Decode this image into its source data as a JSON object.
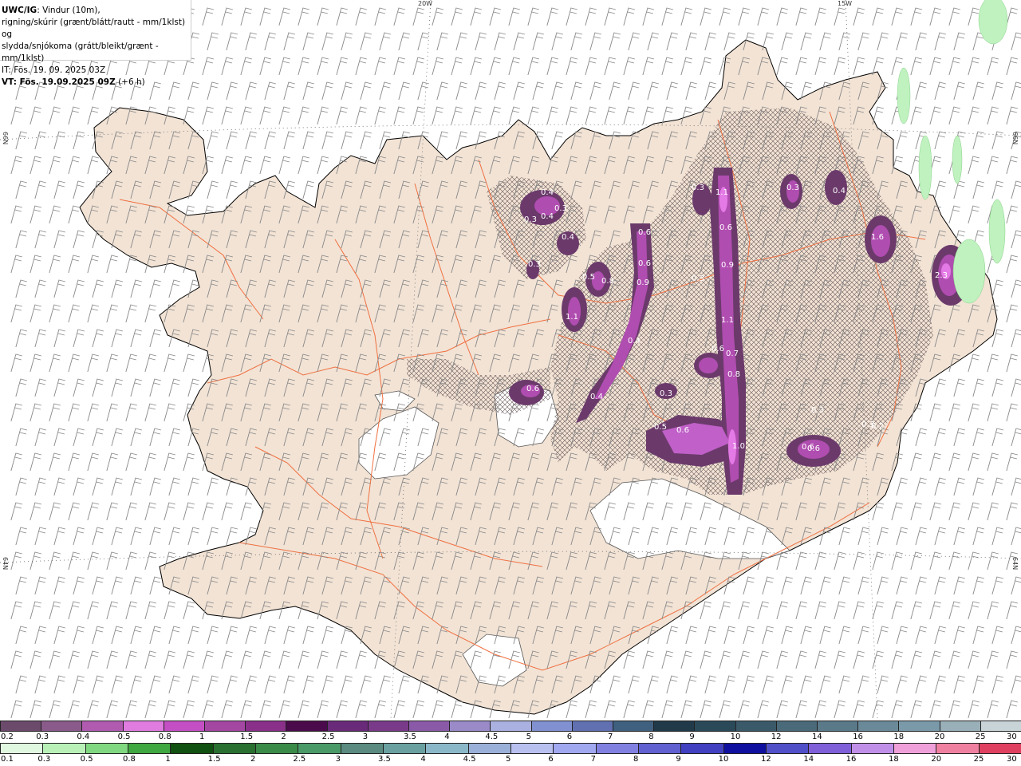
{
  "header": {
    "title_bold": "UWC/IG",
    "title_rest": ": Vindur (10m),",
    "line2": "rigning/skúrir (grænt/blátt/rautt - mm/1klst) og",
    "line3": "slydda/snjókoma (grátt/bleikt/grænt - mm/1klst)",
    "line4": "IT: Fös. 19. 09. 2025 03Z",
    "line5_bold": "VT: Fös. 19.09.2025 09Z",
    "line5_rest": " (+6 h)"
  },
  "axis_labels": {
    "top_20w": "20W",
    "top_15w": "15W",
    "left_66n": "66N",
    "right_66n": "66N",
    "left_64n": "64N",
    "right_64n": "64N"
  },
  "precip_values": [
    "0.4",
    "0.3",
    "0.4",
    "0.3",
    "0.4",
    "0.3",
    "0.5",
    "0.8",
    "1.1",
    "0.6",
    "0.6",
    "0.9",
    "0.4",
    "0.4",
    "0.3",
    "1.1",
    "0.6",
    "0.9",
    "1.1",
    "0.6",
    "0.7",
    "0.8",
    "0.3",
    "0.5",
    "0.6",
    "1.0",
    "0.6",
    "0.4",
    "0.3",
    "1.6",
    "2.3",
    "0.6",
    "0.3",
    "0.3",
    "0.2",
    "0.3",
    "0.6"
  ],
  "legend_snow": {
    "ticks": [
      "0.2",
      "0.3",
      "0.4",
      "0.5",
      "0.8",
      "1",
      "1.5",
      "2",
      "2.5",
      "3",
      "3.5",
      "4",
      "4.5",
      "5",
      "6",
      "7",
      "8",
      "9",
      "10",
      "12",
      "14",
      "16",
      "18",
      "20",
      "25",
      "30"
    ],
    "colors": [
      "#6b4a6b",
      "#8a5a8a",
      "#b05bb0",
      "#e07be0",
      "#c44fc4",
      "#a347a3",
      "#8a2f8a",
      "#4b0a4b",
      "#6a2a7a",
      "#7a3a8a",
      "#8a5aa8",
      "#9a8ac8",
      "#aab0e0",
      "#8090d0",
      "#6070b0",
      "#406080",
      "#203a4a",
      "#2a4a5a",
      "#3a5a6a",
      "#4a6a7a",
      "#5a7a8a",
      "#6a8a9a",
      "#7a9aaa",
      "#9ab0b8",
      "#c8d4d8"
    ]
  },
  "legend_rain": {
    "ticks": [
      "0.1",
      "0.3",
      "0.5",
      "0.8",
      "1",
      "1.5",
      "2",
      "2.5",
      "3",
      "3.5",
      "4",
      "4.5",
      "5",
      "6",
      "7",
      "8",
      "9",
      "10",
      "12",
      "14",
      "16",
      "18",
      "20",
      "25",
      "30"
    ],
    "colors": [
      "#e0f8e0",
      "#b8f0b8",
      "#80d880",
      "#40a840",
      "#105010",
      "#2a7030",
      "#3a8a48",
      "#4a9a68",
      "#5a8a80",
      "#6aa0a0",
      "#8ab8c8",
      "#9ab0d8",
      "#b8c0f0",
      "#a0a8f0",
      "#8080e0",
      "#6060d0",
      "#4040c0",
      "#1010a0",
      "#5050c8",
      "#8060d8",
      "#c090e8",
      "#f0a0d8",
      "#f080a0",
      "#e04060"
    ]
  }
}
